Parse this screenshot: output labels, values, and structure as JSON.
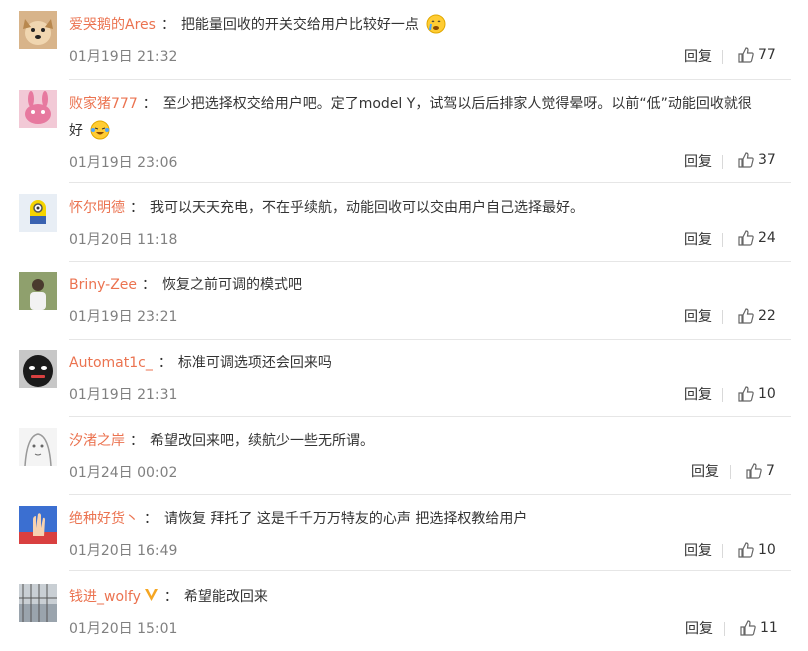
{
  "reply_label": "回复",
  "colors": {
    "username": "#eb7350",
    "text": "#333333",
    "time": "#808080",
    "divider": "#e6e6e6"
  },
  "comments": [
    {
      "username": "爱哭鹅的Ares",
      "text": "把能量回收的开关交给用户比较好一点",
      "emoji": "crying-face-icon",
      "time": "01月19日 21:32",
      "likes": "77"
    },
    {
      "username": "败家猪777",
      "text_line1": "至少把选择权交给用户吧。定了model Y，试驾以后后排家人觉得晕呀。以前“低”动能回收就很",
      "text_line2": "好",
      "emoji": "laughing-crying-face-icon",
      "time": "01月19日 23:06",
      "likes": "37"
    },
    {
      "username": "怀尔明德",
      "text": "我可以天天充电，不在乎续航，动能回收可以交由用户自己选择最好。",
      "time": "01月20日 11:18",
      "likes": "24"
    },
    {
      "username": "Briny-Zee",
      "text": "恢复之前可调的模式吧",
      "time": "01月19日 23:21",
      "likes": "22"
    },
    {
      "username": "Automat1c_",
      "text": "标准可调选项还会回来吗",
      "time": "01月19日 21:31",
      "likes": "10"
    },
    {
      "username": "汐渚之岸",
      "text": "希望改回来吧，续航少一些无所谓。",
      "time": "01月24日 00:02",
      "likes": "7"
    },
    {
      "username": "绝种好货丶",
      "text": "请恢复 拜托了 这是千千万万特友的心声 把选择权教给用户",
      "time": "01月20日 16:49",
      "likes": "10"
    },
    {
      "username": "钱进_wolfy",
      "text": "希望能改回来",
      "time": "01月20日 15:01",
      "likes": "11",
      "badge": "verified-v-icon"
    }
  ]
}
